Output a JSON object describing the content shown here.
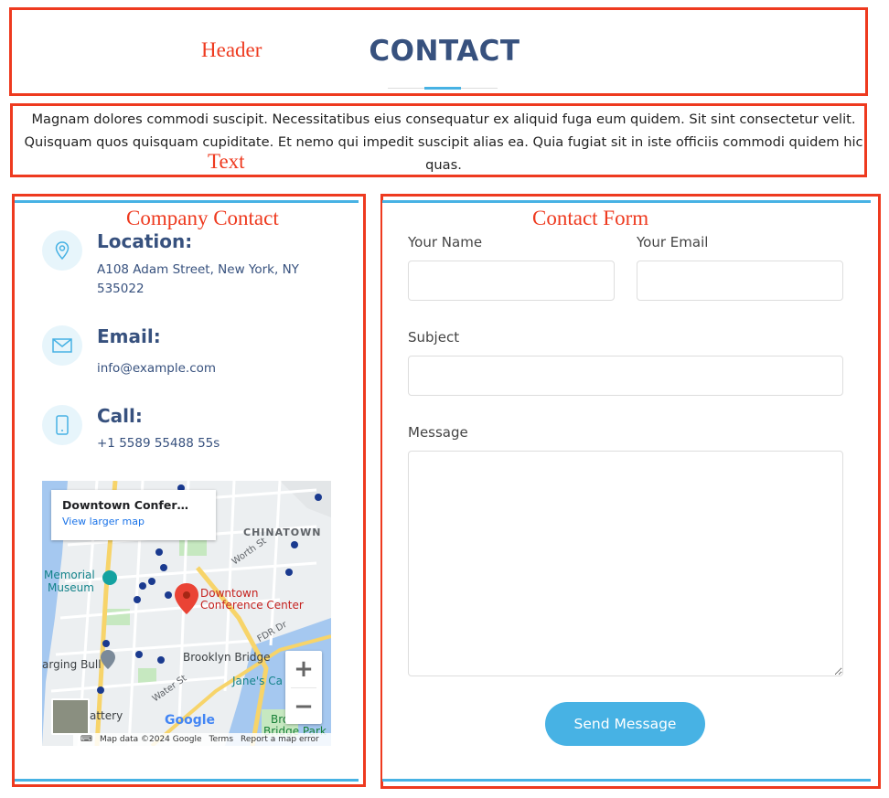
{
  "annotations": {
    "header": "Header",
    "text": "Text",
    "company_contact": "Company Contact",
    "contact_form": "Contact Form"
  },
  "section": {
    "title": "CONTACT",
    "intro": "Magnam dolores commodi suscipit. Necessitatibus eius consequatur ex aliquid fuga eum quidem. Sit sint consectetur velit. Quisquam quos quisquam cupiditate. Et nemo qui impedit suscipit alias ea. Quia fugiat sit in iste officiis commodi quidem hic quas."
  },
  "info": {
    "location": {
      "heading": "Location:",
      "value": "A108 Adam Street, New York, NY 535022",
      "icon": "map-pin-icon"
    },
    "email": {
      "heading": "Email:",
      "value": "info@example.com",
      "icon": "envelope-icon"
    },
    "call": {
      "heading": "Call:",
      "value": "+1 5589 55488 55s",
      "icon": "phone-icon"
    }
  },
  "map": {
    "place_title": "Downtown Confer…",
    "larger_map_link": "View larger map",
    "pin_label_line1": "Downtown",
    "pin_label_line2": "Conference Center",
    "labels": {
      "chinatown": "CHINATOWN",
      "memorial": "Memorial",
      "museum": "Museum",
      "brooklyn_bridge": "Brooklyn Bridge",
      "janes": "Jane's Ca",
      "charging_bull": "arging Bull",
      "battery": "attery",
      "bridge_park_1": "Bro",
      "bridge_park_2": "Bridge Park",
      "worth_st": "Worth St",
      "water_st": "Water St",
      "fdr_dr": "FDR Dr"
    },
    "zoom_in": "+",
    "zoom_out": "−",
    "google": "Google",
    "map_data": "Map data ©2024 Google",
    "terms": "Terms",
    "report": "Report a map error",
    "colors": {
      "water": "#a5c8f0",
      "park": "#c6e8c0",
      "highway": "#f7d46a",
      "pin": "#ea4335"
    }
  },
  "form": {
    "name_label": "Your Name",
    "email_label": "Your Email",
    "subject_label": "Subject",
    "message_label": "Message",
    "name_value": "",
    "email_value": "",
    "subject_value": "",
    "message_value": "",
    "submit_label": "Send Message"
  },
  "colors": {
    "accent": "#47b2e4",
    "heading": "#37517e",
    "annotation": "#ee3a1f"
  }
}
